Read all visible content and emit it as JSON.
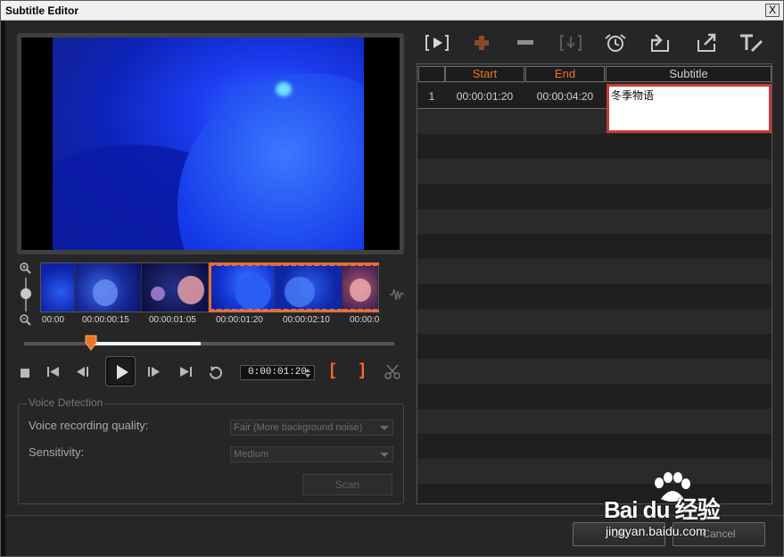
{
  "window": {
    "title": "Subtitle Editor",
    "close_glyph": "X"
  },
  "timeline": {
    "timecodes": [
      "00:00",
      "00:00:00:15",
      "00:00:01:05",
      "00:00:01:20",
      "00:00:02:10",
      "00:00:0"
    ],
    "playhead_fraction": 0.18
  },
  "transport": {
    "timecode": "0:00:01:20",
    "mark_in": "[",
    "mark_out": "]"
  },
  "voice_detection": {
    "legend": "Voice Detection",
    "quality_label": "Voice recording quality:",
    "quality_value": "Fair (More background noise)",
    "sensitivity_label": "Sensitivity:",
    "sensitivity_value": "Medium",
    "scan_label": "Scan"
  },
  "toolbar_icons": [
    "play-subtitle-icon",
    "add-subtitle-icon",
    "remove-subtitle-icon",
    "merge-subtitle-icon",
    "time-offset-icon",
    "import-subtitle-icon",
    "export-subtitle-icon",
    "text-options-icon"
  ],
  "grid": {
    "headers": {
      "index": "",
      "start": "Start",
      "end": "End",
      "subtitle": "Subtitle"
    },
    "rows": [
      {
        "index": "1",
        "start": "00:00:01:20",
        "end": "00:00:04:20",
        "subtitle": "冬季物语"
      }
    ]
  },
  "buttons": {
    "ok": "OK",
    "cancel": "Cancel"
  },
  "watermark": {
    "brand": "Bai du 经验",
    "url": "jingyan.baidu.com"
  },
  "colors": {
    "accent": "#ff6a2b",
    "header_text": "#e8742c",
    "edit_border": "#c83a3a"
  }
}
